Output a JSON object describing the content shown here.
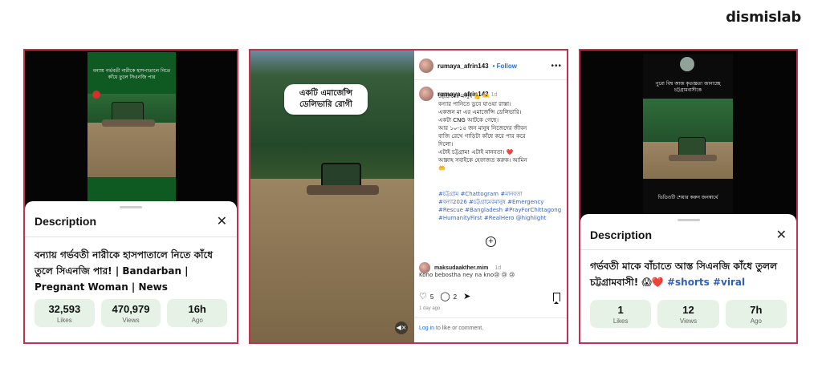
{
  "brand": "dismislab",
  "colors": {
    "frame_border": "#c0334e",
    "stat_bg": "#e6f2e6",
    "hashtag": "#2f5fbf",
    "follow": "#1f6fd6"
  },
  "panel_left": {
    "thumb_caption": "বন্যায় গর্ভবতী নারীকে হাসপাতালে নিতে কাঁধে তুলে সিএনজি পার",
    "sheet_title": "Description",
    "close_icon": "close-icon",
    "description": "বন্যায় গর্ভবতী নারীকে হাসপাতালে নিতে কাঁধে তুলে সিএনজি পার! | Bandarban | Pregnant Woman | News",
    "stats": [
      {
        "value": "32,593",
        "label": "Likes"
      },
      {
        "value": "470,979",
        "label": "Views"
      },
      {
        "value": "16h",
        "label": "Ago"
      }
    ]
  },
  "panel_middle": {
    "bubble_text": "একটি এমার্জেন্সি ডেলিভারি রোগী",
    "username": "rumaya_afrin143",
    "follow": "• Follow",
    "more": "•••",
    "caption_user": "rumaya_afrin143",
    "caption_ago": "1d",
    "caption": "চট্টগ্রামের মানুষ 💪 🫶\nবন্যার পানিতে ডুবে যাওয়া রাস্তা।\nএকজন মা এর এমার্জেন্সি ডেলিভারি।\nএকটা CNG আটকে গেছে।\nআর ১০-১৫ জন মানুষ নিজেদের জীবন\nবাজি রেখে গাড়িটা কাঁধে করে পার করে\nদিলো।\nএটাই চট্টগ্রাম! এটাই মানবতা। ❤️\nআল্লাহ সবাইকে হেফাজত করুক। আমিন\n🤲",
    "hashtags": "#চট্টগ্রাম #Chattogram #মানবতা\n#বন্যা2026 #চট্টগ্রামেরমানুষ #Emergency\n#Rescue #Bangladesh #PrayForChittagong\n#HumanityFirst #RealHero @highlight",
    "comment_user": "maksudaakther.mim",
    "comment_ago": "1d",
    "comment_text": "Kono bebostha ney na kno😢 😢 😢",
    "likes_count": "5",
    "comments_count": "2",
    "days_ago": "1 day ago",
    "login_link": "Log in",
    "login_text": " to like or comment."
  },
  "panel_right": {
    "thumb_caption_top": "পুরো বিশ্ব আজ কৃতজ্ঞতা জানাচ্ছে চট্টগ্রামবাসীকে",
    "thumb_caption_bottom": "ভিডিওটি শেয়ার করুন জনস্বার্থে",
    "sheet_title": "Description",
    "description": "গর্ভবতী মাকে বাঁচাতে আস্ত সিএনজি কাঁধে তুলল চট্টগ্রামবাসী! 😱❤️",
    "hashtags": "#shorts #viral",
    "stats": [
      {
        "value": "1",
        "label": "Likes"
      },
      {
        "value": "12",
        "label": "Views"
      },
      {
        "value": "7h",
        "label": "Ago"
      }
    ]
  }
}
